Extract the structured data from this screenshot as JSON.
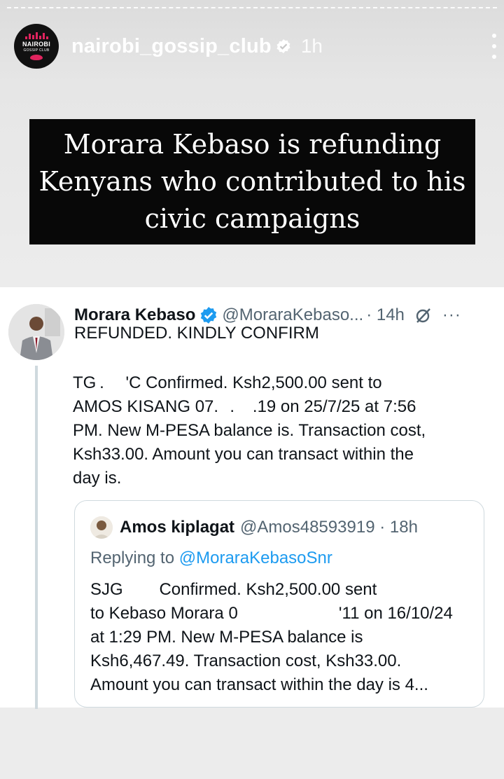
{
  "story": {
    "account_logo_line1": "NAIROBI",
    "account_logo_line2": "GOSSIP CLUB",
    "username": "nairobi_gossip_club",
    "time_ago": "1h",
    "more_icon": "vertical-dots-icon",
    "verified_icon": "verified-badge-icon"
  },
  "headline": {
    "line1": "Morara Kebaso is refunding",
    "line2": "Kenyans who contributed to his",
    "line3": "civic campaigns"
  },
  "tweet": {
    "name": "Morara Kebaso",
    "handle": "@MoraraKebaso...",
    "time": "· 14h",
    "more": "···",
    "text_line1": "REFUNDED. KINDLY CONFIRM",
    "body_lines": [
      "TG .      'C Confirmed. Ksh2,500.00 sent to",
      "AMOS  KISANG 07.   .     .19 on 25/7/25 at 7:56",
      "PM. New M-PESA balance is. Transaction cost,",
      "Ksh33.00.  Amount you can transact within the",
      "day is."
    ],
    "colors": {
      "verified": "#1d9bf0",
      "text": "#0f1419",
      "muted": "#536471"
    }
  },
  "quote": {
    "name": "Amos kiplagat",
    "handle": "@Amos48593919 · 18h",
    "replying_prefix": "Replying to",
    "replying_to": "@MoraraKebasoSnr",
    "body_lines": [
      "SJG          Confirmed. Ksh2,500.00 sent",
      "to Kebaso  Morara 0                              '11 on 16/10/24",
      "at 1:29 PM. New M-PESA balance is",
      "Ksh6,467.49. Transaction cost, Ksh33.00.",
      "Amount you can transact within the day is 4..."
    ]
  }
}
